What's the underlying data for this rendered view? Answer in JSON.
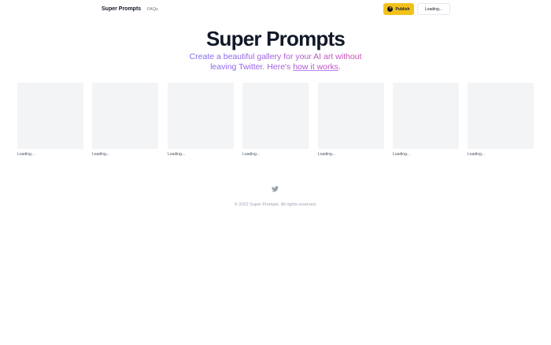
{
  "header": {
    "brand": "Super Prompts",
    "faq_label": "FAQs",
    "publish_label": "Publish",
    "user_button_label": "Loading..."
  },
  "hero": {
    "title": "Super Prompts",
    "subtitle_line1": "Create a beautiful gallery for your AI art without",
    "subtitle_line2_prefix": "leaving Twitter. Here's ",
    "subtitle_link": "how it works",
    "subtitle_suffix": "."
  },
  "gallery": {
    "items": [
      {
        "label": "Loading..."
      },
      {
        "label": "Loading..."
      },
      {
        "label": "Loading..."
      },
      {
        "label": "Loading..."
      },
      {
        "label": "Loading..."
      },
      {
        "label": "Loading..."
      },
      {
        "label": "Loading..."
      }
    ]
  },
  "footer": {
    "copyright": "© 2022 Super Prompts. All rights reserved."
  },
  "icons": {
    "publish": "plus-circle-icon",
    "social": "twitter-icon"
  },
  "colors": {
    "accent": "#f2c21b",
    "gradient_start": "#7c6cf2",
    "gradient_end": "#d946a8"
  }
}
